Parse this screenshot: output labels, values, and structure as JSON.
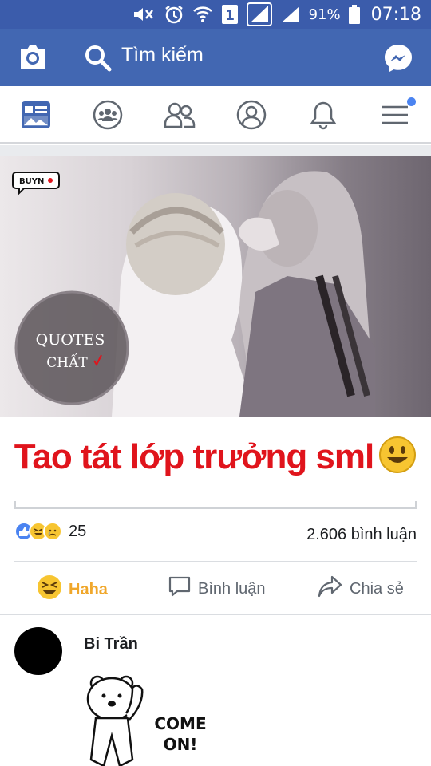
{
  "status_bar": {
    "icons": [
      "mute-icon",
      "alarm-icon",
      "wifi-icon",
      "sim-1-icon",
      "signal-icon",
      "signal-icon",
      "battery-icon"
    ],
    "sim_label": "1",
    "battery": "91%",
    "time": "07:18"
  },
  "app_bar": {
    "search_placeholder": "Tìm kiếm",
    "colors": {
      "bar": "#4267b2",
      "status": "#3b5cab"
    }
  },
  "tabs": [
    {
      "name": "news-feed",
      "icon": "news-feed-icon",
      "active": true
    },
    {
      "name": "groups",
      "icon": "groups-icon"
    },
    {
      "name": "friends",
      "icon": "friends-icon"
    },
    {
      "name": "profile",
      "icon": "profile-icon"
    },
    {
      "name": "notifications",
      "icon": "bell-icon"
    },
    {
      "name": "menu",
      "icon": "hamburger-icon",
      "badge": true
    }
  ],
  "post": {
    "image_tag": "BUYN",
    "watermark_line1": "QUOTES",
    "watermark_line2": "CHẤT",
    "caption": "Tao tát lớp trưởng sml",
    "reaction_count": "25",
    "comment_count": "2.606 bình luận",
    "actions": {
      "haha": "Haha",
      "comment": "Bình luận",
      "share": "Chia sẻ"
    },
    "colors": {
      "caption": "#e0141c",
      "haha": "#f0a72b"
    }
  },
  "comment": {
    "author": "Bi Trần",
    "sticker_text_1": "COME",
    "sticker_text_2": "ON!"
  }
}
